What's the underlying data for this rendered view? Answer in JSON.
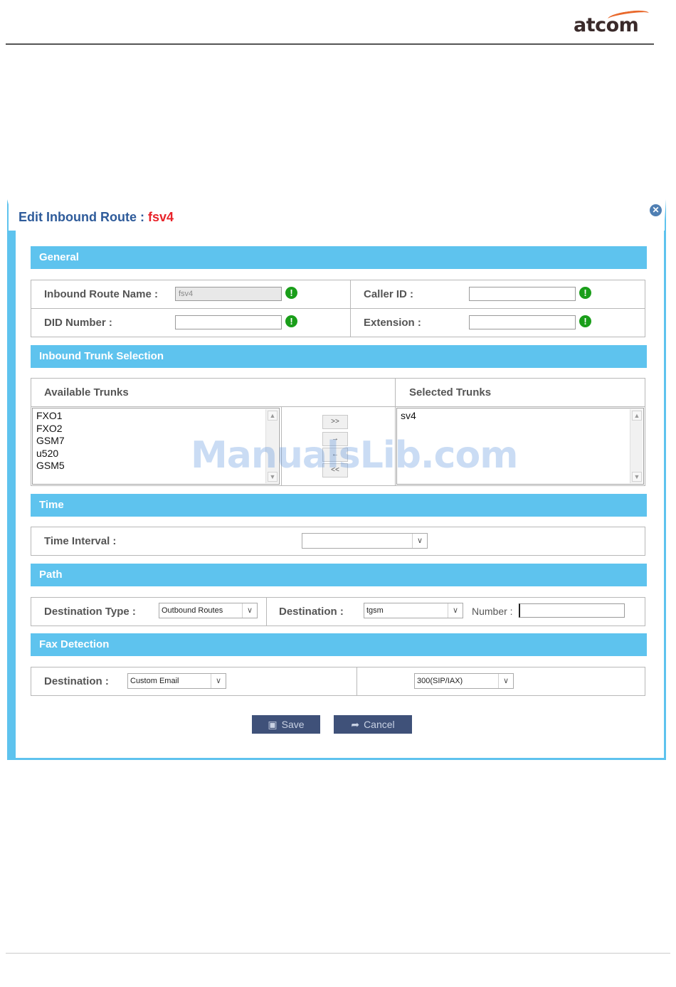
{
  "brand": {
    "logo_text": "atcom"
  },
  "dialog": {
    "title_prefix": "Edit Inbound Route : ",
    "title_name": "fsv4",
    "close_glyph": "✕"
  },
  "general": {
    "section_label": "General",
    "route_name_label": "Inbound Route Name :",
    "route_name_value": "fsv4",
    "caller_id_label": "Caller ID :",
    "caller_id_value": "",
    "did_label": "DID Number :",
    "did_value": "",
    "extension_label": "Extension :",
    "extension_value": "",
    "ok_glyph": "!"
  },
  "trunks": {
    "section_label": "Inbound Trunk Selection",
    "available_label": "Available Trunks",
    "selected_label": "Selected Trunks",
    "available": [
      "FXO1",
      "FXO2",
      "GSM7",
      "u520",
      "GSM5"
    ],
    "selected": [
      "sv4"
    ],
    "move_all_right": ">>",
    "move_right": "→",
    "move_left": "←",
    "move_all_left": "<<"
  },
  "time": {
    "section_label": "Time",
    "interval_label": "Time Interval :",
    "interval_value": ""
  },
  "path": {
    "section_label": "Path",
    "dest_type_label": "Destination Type :",
    "dest_type_value": "Outbound Routes",
    "destination_label": "Destination :",
    "destination_value": "tgsm",
    "number_label": "Number :",
    "number_value": ""
  },
  "fax": {
    "section_label": "Fax Detection",
    "destination_label": "Destination :",
    "destination_value": "Custom Email",
    "second_value": "300(SIP/IAX)"
  },
  "actions": {
    "save_label": "Save",
    "cancel_label": "Cancel"
  },
  "watermark": "ManualsLib.com",
  "colors": {
    "section_bar": "#5ec3ee",
    "title": "#2e5b9a",
    "title_name": "#e8232a",
    "ok_icon": "#1a9e1a",
    "button": "#3f5179"
  }
}
